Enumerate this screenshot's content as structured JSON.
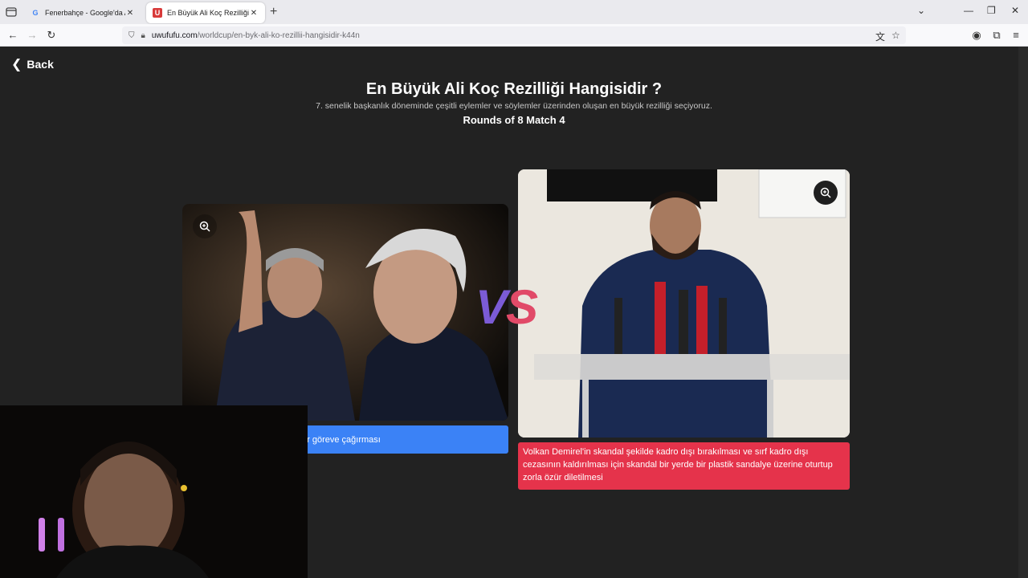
{
  "browser": {
    "tabs": [
      {
        "title": "Fenerbahçe - Google'da Ara",
        "favicon": "G",
        "active": false
      },
      {
        "title": "En Büyük Ali Koç Rezilliği Hangi",
        "favicon": "U",
        "active": true
      }
    ],
    "url_host": "uwufufu.com",
    "url_path": "/worldcup/en-byk-ali-ko-rezillii-hangisidir-k44n"
  },
  "page": {
    "back_label": "Back",
    "title": "En Büyük Ali Koç Rezilliği Hangisidir ?",
    "subtitle": "7. senelik başkanlık döneminde çeşitli eylemler ve söylemler üzerinden oluşan en büyük rezilliği seçiyoruz.",
    "rounds": "Rounds of 8 Match 4",
    "vs_v": "V",
    "vs_s": "S",
    "left_option": {
      "label": "p Jorge Jesus sonrası tekrar göreve çağırması",
      "color": "#3b82f6"
    },
    "right_option": {
      "label": "Volkan Demirel'in skandal şekilde kadro dışı bırakılması ve sırf kadro dışı cezasının kaldırılması için skandal bir yerde bir plastik sandalye üzerine oturtup zorla özür diletilmesi",
      "color": "#e5334b"
    }
  }
}
